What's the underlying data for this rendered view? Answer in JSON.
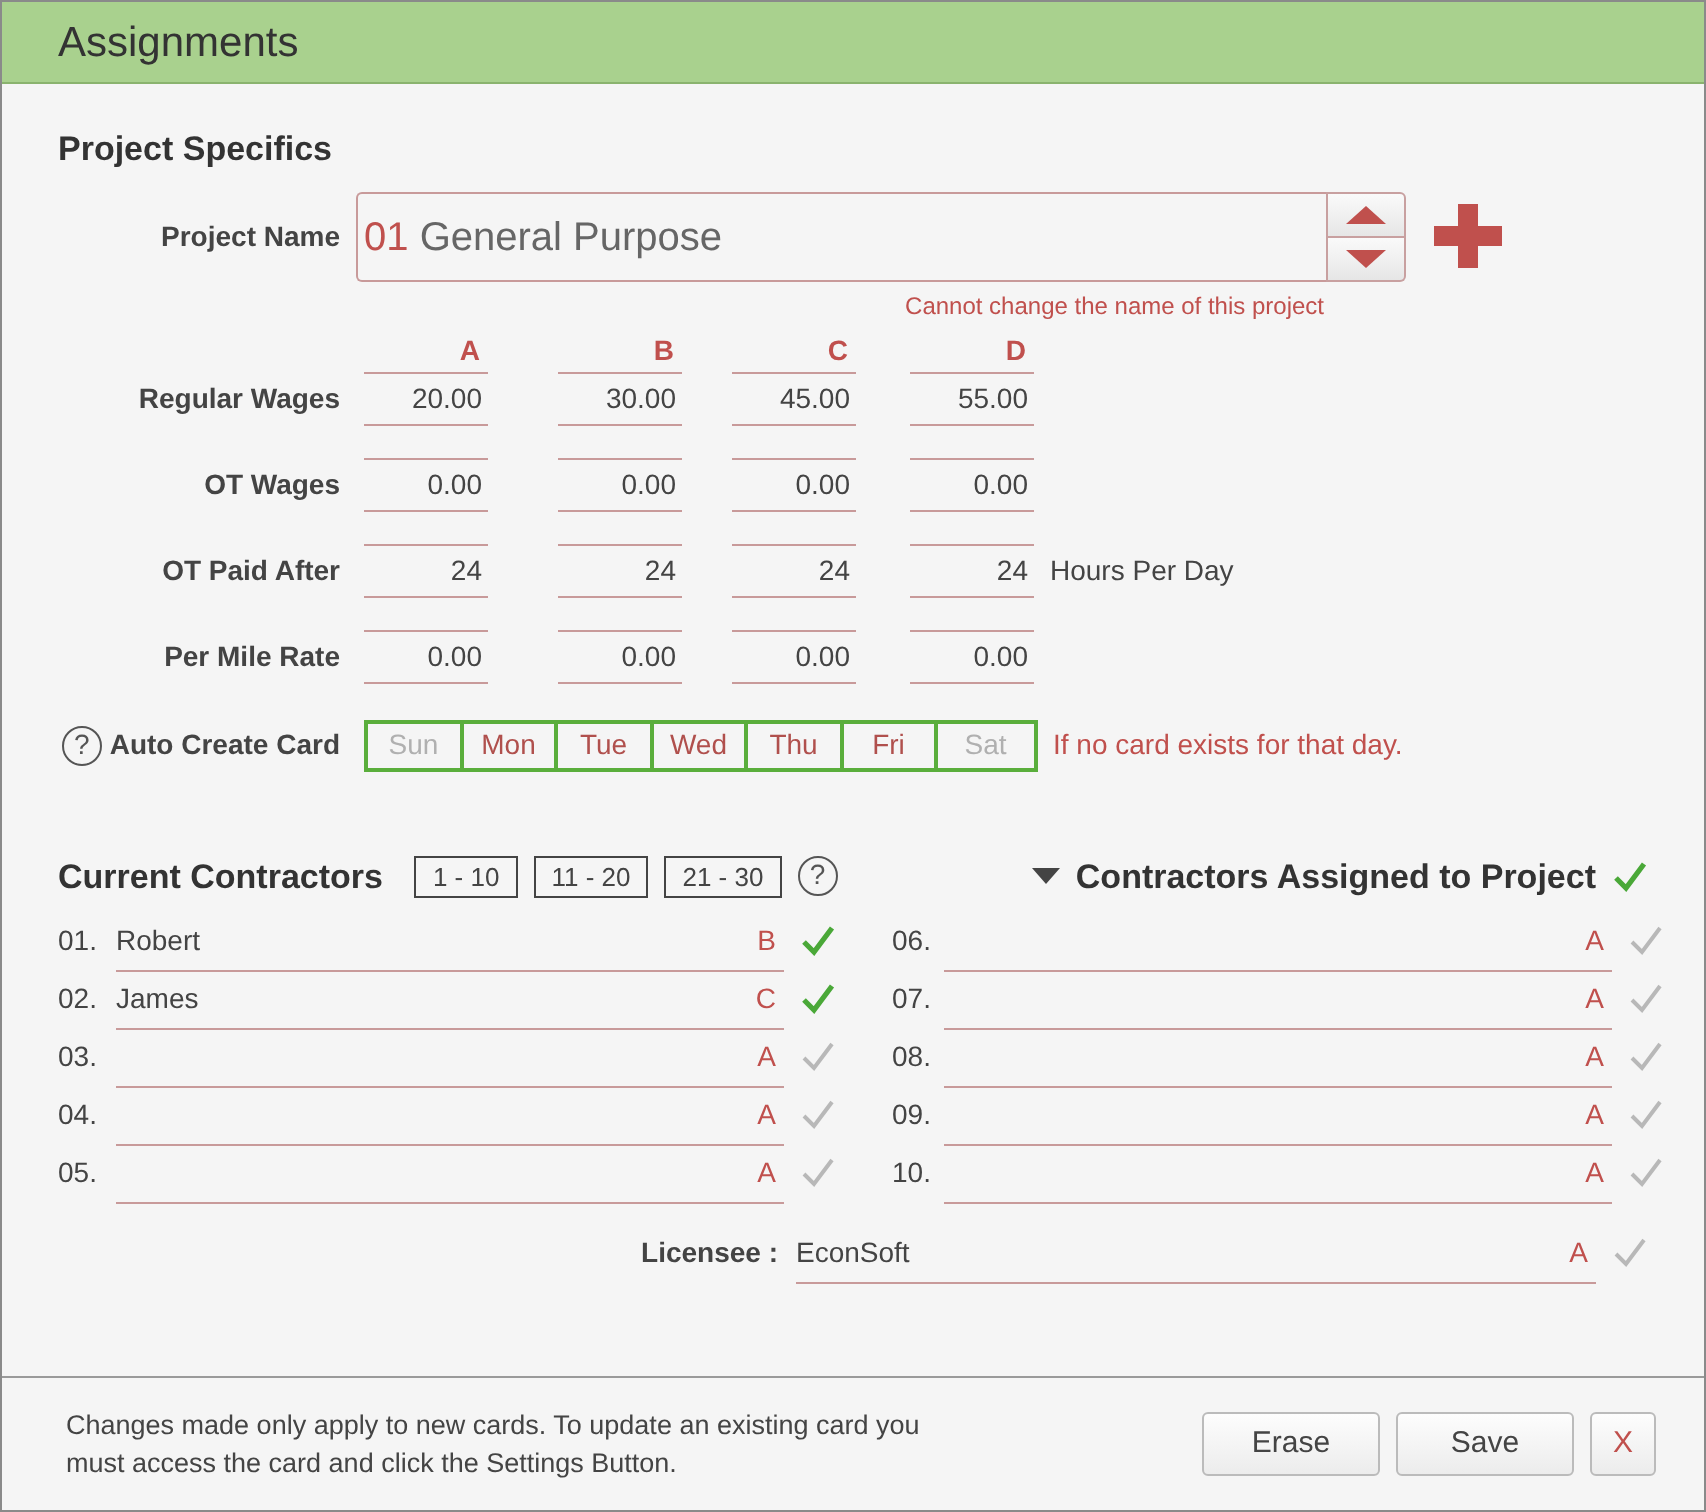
{
  "window": {
    "title": "Assignments"
  },
  "project": {
    "section_title": "Project Specifics",
    "name_label": "Project Name",
    "number": "01",
    "name": "General Purpose",
    "note": "Cannot change the name of this project"
  },
  "wage_columns": [
    "A",
    "B",
    "C",
    "D"
  ],
  "wage_rows": [
    {
      "label": "Regular Wages",
      "values": [
        "20.00",
        "30.00",
        "45.00",
        "55.00"
      ]
    },
    {
      "label": "OT Wages",
      "values": [
        "0.00",
        "0.00",
        "0.00",
        "0.00"
      ]
    },
    {
      "label": "OT Paid After",
      "values": [
        "24",
        "24",
        "24",
        "24"
      ],
      "suffix": "Hours Per Day"
    },
    {
      "label": "Per Mile Rate",
      "values": [
        "0.00",
        "0.00",
        "0.00",
        "0.00"
      ]
    }
  ],
  "auto_create": {
    "help": "?",
    "label": "Auto Create Card",
    "note": "If no card exists for that day.",
    "days": [
      {
        "label": "Sun",
        "selected": false
      },
      {
        "label": "Mon",
        "selected": true
      },
      {
        "label": "Tue",
        "selected": true
      },
      {
        "label": "Wed",
        "selected": true
      },
      {
        "label": "Thu",
        "selected": true
      },
      {
        "label": "Fri",
        "selected": true
      },
      {
        "label": "Sat",
        "selected": false
      }
    ]
  },
  "contractors": {
    "title": "Current Contractors",
    "pages": [
      "1 - 10",
      "11 - 20",
      "21 - 30"
    ],
    "help": "?",
    "assigned_title": "Contractors Assigned to Project",
    "assigned_checked": true,
    "rows": [
      {
        "number": "01.",
        "name": "Robert",
        "rate": "B",
        "checked": true
      },
      {
        "number": "02.",
        "name": "James",
        "rate": "C",
        "checked": true
      },
      {
        "number": "03.",
        "rate": "A",
        "checked": false
      },
      {
        "number": "04.",
        "rate": "A",
        "checked": false
      },
      {
        "number": "05.",
        "rate": "A",
        "checked": false
      },
      {
        "number": "06.",
        "rate": "A",
        "checked": false
      },
      {
        "number": "07.",
        "rate": "A",
        "checked": false
      },
      {
        "number": "08.",
        "rate": "A",
        "checked": false
      },
      {
        "number": "09.",
        "rate": "A",
        "checked": false
      },
      {
        "number": "10.",
        "rate": "A",
        "checked": false
      }
    ],
    "licensee": {
      "label": "Licensee :",
      "name": "EconSoft",
      "rate": "A",
      "checked": false
    }
  },
  "footer": {
    "note": "Changes made only apply to new cards. To update an existing card you must access the card and click the Settings Button.",
    "buttons": [
      "Erase",
      "Save",
      "X"
    ]
  }
}
